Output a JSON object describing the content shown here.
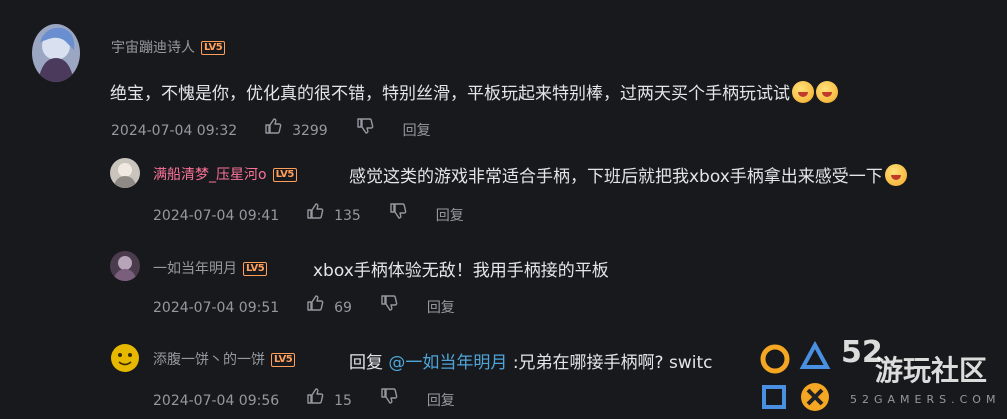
{
  "colors": {
    "background": "#18191c",
    "text": "#e3e5e7",
    "meta": "#9499a0",
    "vip_name": "#fb7299",
    "level_badge": "#ff9f5a",
    "mention": "#4fa5d9"
  },
  "comment": {
    "username": "宇宙蹦迪诗人",
    "level": "LV5",
    "text": "绝宝，不愧是你，优化真的很不错，特别丝滑，平板玩起来特别棒，过两天买个手柄玩试试",
    "emojis": [
      "emoji-face",
      "emoji-face"
    ],
    "time": "2024-07-04 09:32",
    "likes": "3299",
    "reply_label": "回复"
  },
  "replies": [
    {
      "username": "满船清梦_压星河o",
      "level": "LV5",
      "text": "感觉这类的游戏非常适合手柄，下班后就把我xbox手柄拿出来感受一下",
      "time": "2024-07-04 09:41",
      "likes": "135",
      "reply_label": "回复"
    },
    {
      "username": "一如当年明月",
      "level": "LV5",
      "text": "xbox手柄体验无敌！我用手柄接的平板",
      "time": "2024-07-04 09:51",
      "likes": "69",
      "reply_label": "回复"
    },
    {
      "username": "添腹一饼丶的一饼",
      "level": "LV5",
      "reply_prefix": "回复",
      "mention": "@一如当年明月",
      "text": ":兄弟在哪接手柄啊? switc",
      "time": "2024-07-04 09:56",
      "likes": "15",
      "reply_label": "回复"
    }
  ],
  "watermark": {
    "number": "52",
    "title": "游玩社区",
    "site": "52GAMERS.COM"
  }
}
